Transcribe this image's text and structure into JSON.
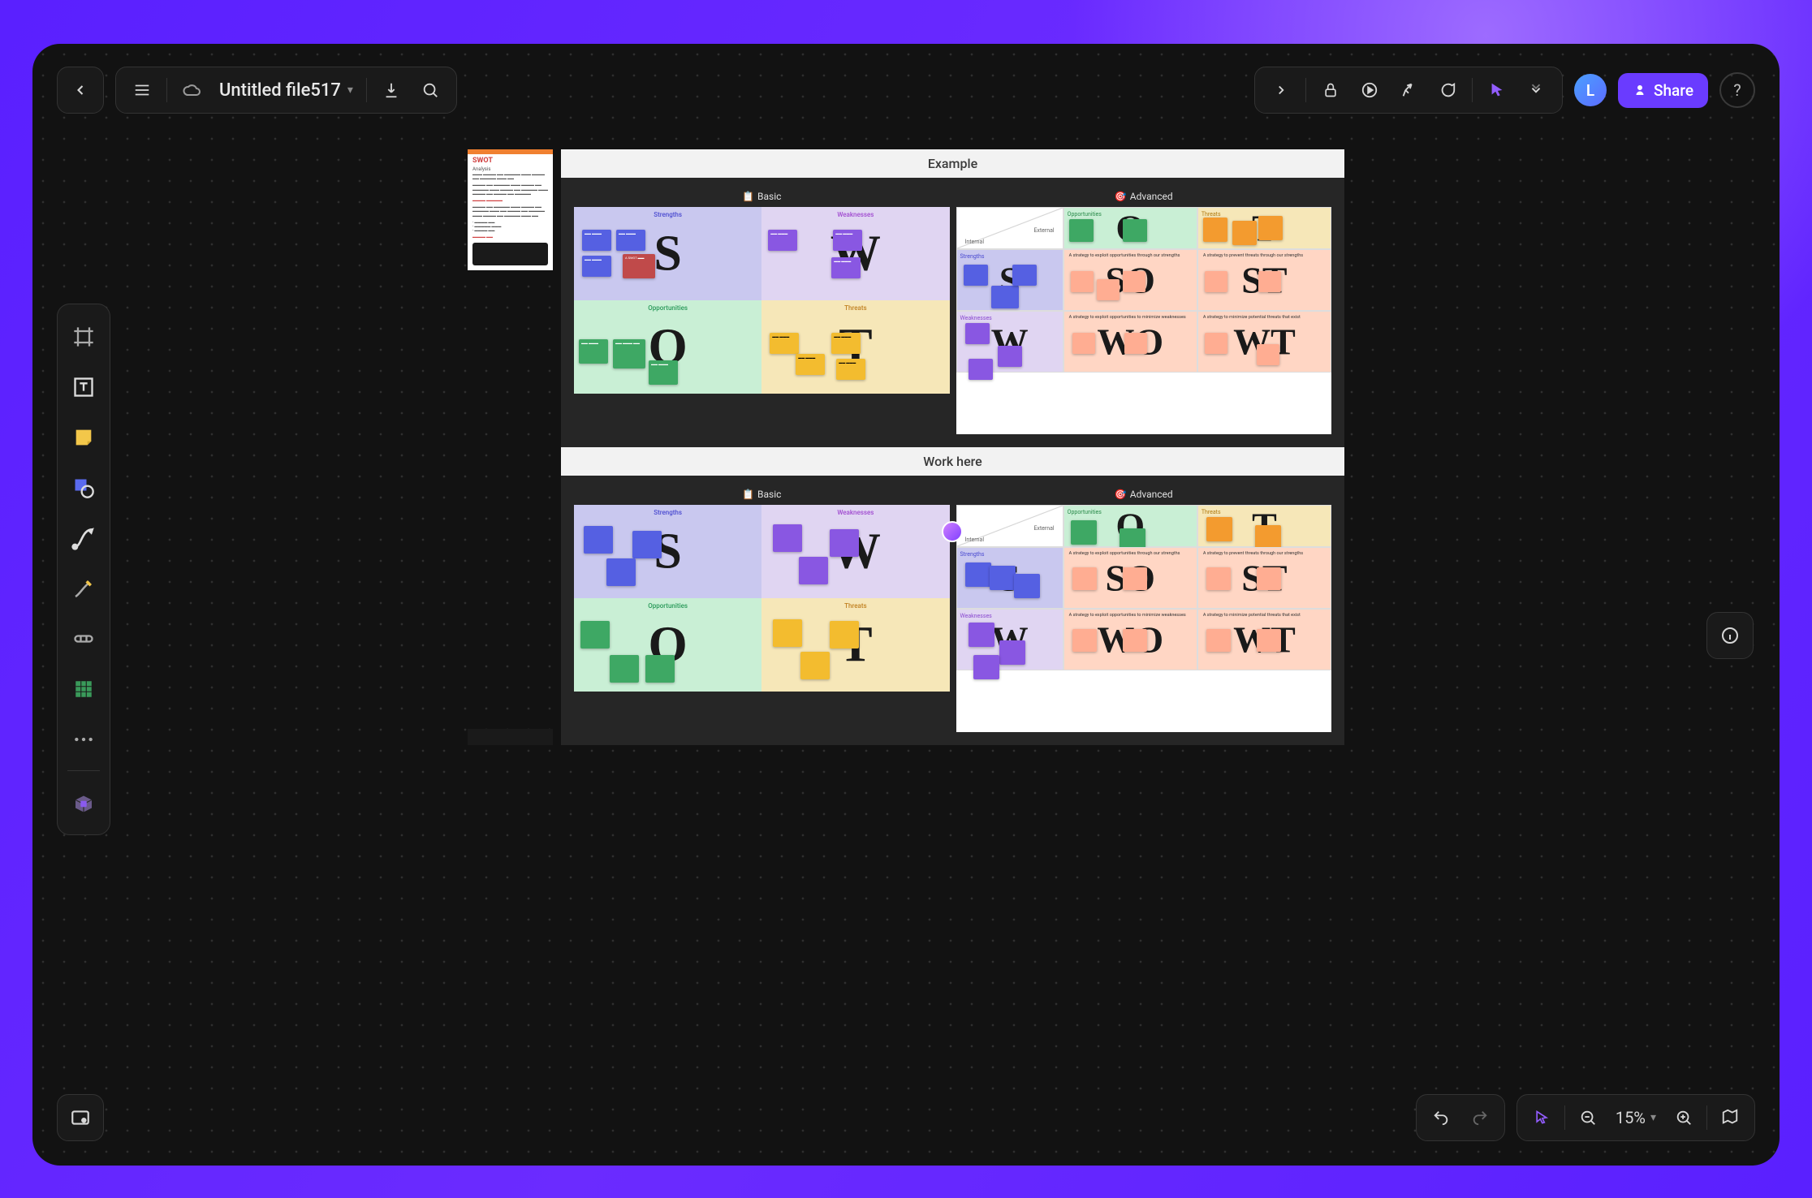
{
  "file": {
    "name": "Untitled file517"
  },
  "avatar": {
    "letter": "L"
  },
  "share": {
    "label": "Share"
  },
  "zoom": {
    "value": "15%"
  },
  "sections": {
    "example": "Example",
    "workhere": "Work here",
    "basic": "Basic",
    "advanced": "Advanced"
  },
  "swotdoc": {
    "title": "SWOT",
    "subtitle": "Analysis"
  },
  "swot": {
    "s": {
      "letter": "S",
      "label": "Strengths"
    },
    "w": {
      "letter": "W",
      "label": "Weaknesses"
    },
    "o": {
      "letter": "O",
      "label": "Opportunities"
    },
    "t": {
      "letter": "T",
      "label": "Threats"
    }
  },
  "tows": {
    "external": "External",
    "internal": "Internal",
    "opportunities": "Opportunities",
    "threats": "Threats",
    "strengths": "Strengths",
    "weaknesses": "Weaknesses",
    "letters": {
      "o": "O",
      "t": "T",
      "s": "S",
      "w": "W",
      "so": "SO",
      "st": "ST",
      "wo": "WO",
      "wt": "WT"
    },
    "strats": {
      "so": "A strategy to exploit opportunities through our strengths",
      "st": "A strategy to prevent threats through our strengths",
      "wo": "A strategy to exploit opportunities to minimize weaknesses",
      "wt": "A strategy to minimize potential threats that exist"
    }
  }
}
